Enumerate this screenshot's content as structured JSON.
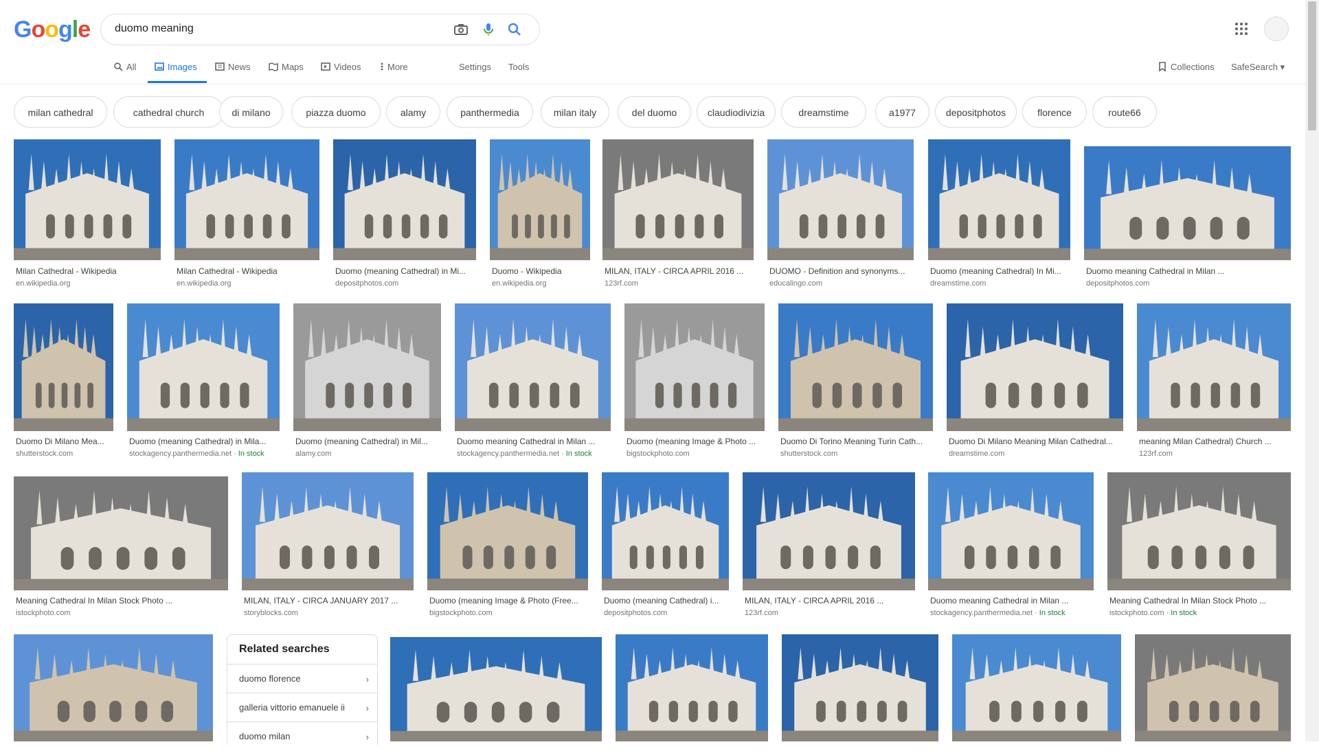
{
  "logo": {
    "text": "Google",
    "letters": [
      "G",
      "o",
      "o",
      "g",
      "l",
      "e"
    ],
    "colors": [
      "#4285F4",
      "#EA4335",
      "#FBBC05",
      "#4285F4",
      "#34A853",
      "#EA4335"
    ]
  },
  "search": {
    "value": "duomo meaning"
  },
  "icons": {
    "camera": "camera-icon",
    "mic": "mic-icon",
    "search": "search-icon",
    "apps": "apps-grid-icon"
  },
  "tabs": [
    {
      "label": "All",
      "icon": "search-icon"
    },
    {
      "label": "Images",
      "icon": "image-icon"
    },
    {
      "label": "News",
      "icon": "news-icon"
    },
    {
      "label": "Maps",
      "icon": "maps-icon"
    },
    {
      "label": "Videos",
      "icon": "video-icon"
    },
    {
      "label": "More",
      "icon": "more-vertical-icon"
    }
  ],
  "tools": {
    "settings": "Settings",
    "tools": "Tools",
    "collections": "Collections",
    "safesearch": "SafeSearch"
  },
  "chips": [
    "milan cathedral",
    "cathedral church",
    "di milano",
    "piazza duomo",
    "alamy",
    "panthermedia",
    "milan italy",
    "del duomo",
    "claudiodivizia",
    "dreamstime",
    "a1977",
    "depositphotos",
    "florence",
    "route66"
  ],
  "results": [
    {
      "title": "Milan Cathedral - Wikipedia",
      "source": "en.wikipedia.org",
      "stock": ""
    },
    {
      "title": "Milan Cathedral - Wikipedia",
      "source": "en.wikipedia.org",
      "stock": ""
    },
    {
      "title": "Duomo (meaning Cathedral) in Mi...",
      "source": "depositphotos.com",
      "stock": ""
    },
    {
      "title": "Duomo - Wikipedia",
      "source": "en.wikipedia.org",
      "stock": ""
    },
    {
      "title": "MILAN, ITALY - CIRCA APRIL 2016 ...",
      "source": "123rf.com",
      "stock": ""
    },
    {
      "title": "DUOMO - Definition and synonyms...",
      "source": "educalingo.com",
      "stock": ""
    },
    {
      "title": "Duomo (meaning Cathedral) In Mi...",
      "source": "dreamstime.com",
      "stock": ""
    },
    {
      "title": "Duomo meaning Cathedral in Milan ...",
      "source": "depositphotos.com",
      "stock": ""
    },
    {
      "title": "Duomo Di Milano Mea...",
      "source": "shutterstock.com",
      "stock": ""
    },
    {
      "title": "Duomo (meaning Cathedral) in Mila...",
      "source": "stockagency.panthermedia.net",
      "stock": "In stock"
    },
    {
      "title": "Duomo (meaning Cathedral) in Mil...",
      "source": "alamy.com",
      "stock": ""
    },
    {
      "title": "Duomo meaning Cathedral in Milan ...",
      "source": "stockagency.panthermedia.net",
      "stock": "In stock"
    },
    {
      "title": "Duomo (meaning Image & Photo ...",
      "source": "bigstockphoto.com",
      "stock": ""
    },
    {
      "title": "Duomo Di Torino Meaning Turin Cath...",
      "source": "shutterstock.com",
      "stock": ""
    },
    {
      "title": "Duomo Di Milano Meaning Milan Cathedral...",
      "source": "dreamstime.com",
      "stock": ""
    },
    {
      "title": "meaning Milan Cathedral) Church ...",
      "source": "123rf.com",
      "stock": ""
    },
    {
      "title": "Meaning Cathedral In Milan Stock Photo ...",
      "source": "istockphoto.com",
      "stock": ""
    },
    {
      "title": "MILAN, ITALY - CIRCA JANUARY 2017 ...",
      "source": "storyblocks.com",
      "stock": ""
    },
    {
      "title": "Duomo (meaning Image & Photo (Free...",
      "source": "bigstockphoto.com",
      "stock": ""
    },
    {
      "title": "Duomo (meaning Cathedral) i...",
      "source": "depositphotos.com",
      "stock": ""
    },
    {
      "title": "MILAN, ITALY - CIRCA APRIL 2016 ...",
      "source": "123rf.com",
      "stock": ""
    },
    {
      "title": "Duomo meaning Cathedral in Milan ...",
      "source": "stockagency.panthermedia.net",
      "stock": "In stock"
    },
    {
      "title": "Meaning Cathedral In Milan Stock Photo ...",
      "source": "istockphoto.com",
      "stock": "In stock"
    },
    {
      "title": "",
      "source": "",
      "stock": ""
    },
    {
      "title": "",
      "source": "",
      "stock": ""
    },
    {
      "title": "",
      "source": "",
      "stock": ""
    },
    {
      "title": "",
      "source": "",
      "stock": ""
    },
    {
      "title": "",
      "source": "",
      "stock": ""
    },
    {
      "title": "",
      "source": "",
      "stock": ""
    }
  ],
  "related": {
    "title": "Related searches",
    "items": [
      "duomo florence",
      "galleria vittorio emanuele ii",
      "duomo milan"
    ]
  },
  "colors": {
    "accent": "#1a73e8",
    "in_stock": "#188038",
    "sky": "#2f6fb8",
    "stone": "#e6e1d8"
  }
}
